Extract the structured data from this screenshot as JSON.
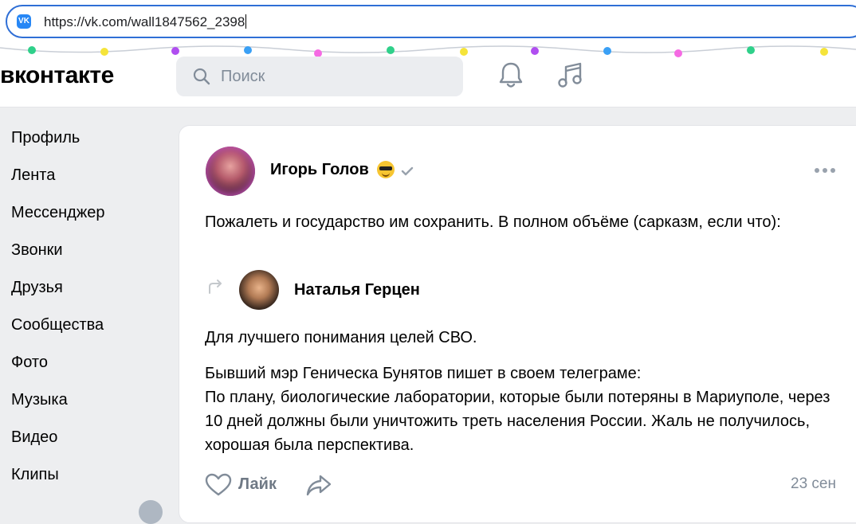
{
  "browser": {
    "url": "https://vk.com/wall1847562_2398",
    "favicon_text": "VK"
  },
  "header": {
    "logo": "вконтакте",
    "search_placeholder": "Поиск"
  },
  "sidebar": {
    "items": [
      {
        "label": "Профиль"
      },
      {
        "label": "Лента"
      },
      {
        "label": "Мессенджер"
      },
      {
        "label": "Звонки"
      },
      {
        "label": "Друзья"
      },
      {
        "label": "Сообщества"
      },
      {
        "label": "Фото"
      },
      {
        "label": "Музыка"
      },
      {
        "label": "Видео"
      },
      {
        "label": "Клипы"
      }
    ]
  },
  "post": {
    "author": "Игорь Голов",
    "text": "Пожалеть и государство им сохранить. В полном объёме (сарказм, если что):",
    "repost": {
      "author": "Наталья Герцен",
      "line1": "Для лучшего понимания целей СВО.",
      "line2": "Бывший мэр Геническа Бунятов пишет в своем телеграме:\nПо плану, биологические лаборатории, которые были потеряны в Мариуполе, через 10 дней должны были уничтожить треть населения России. Жаль не получилось, хорошая была перспектива."
    },
    "like_label": "Лайк",
    "date": "23 сен"
  },
  "colors": {
    "accent": "#2787f5",
    "background": "#edeef0",
    "secondary_text": "#818c99"
  }
}
